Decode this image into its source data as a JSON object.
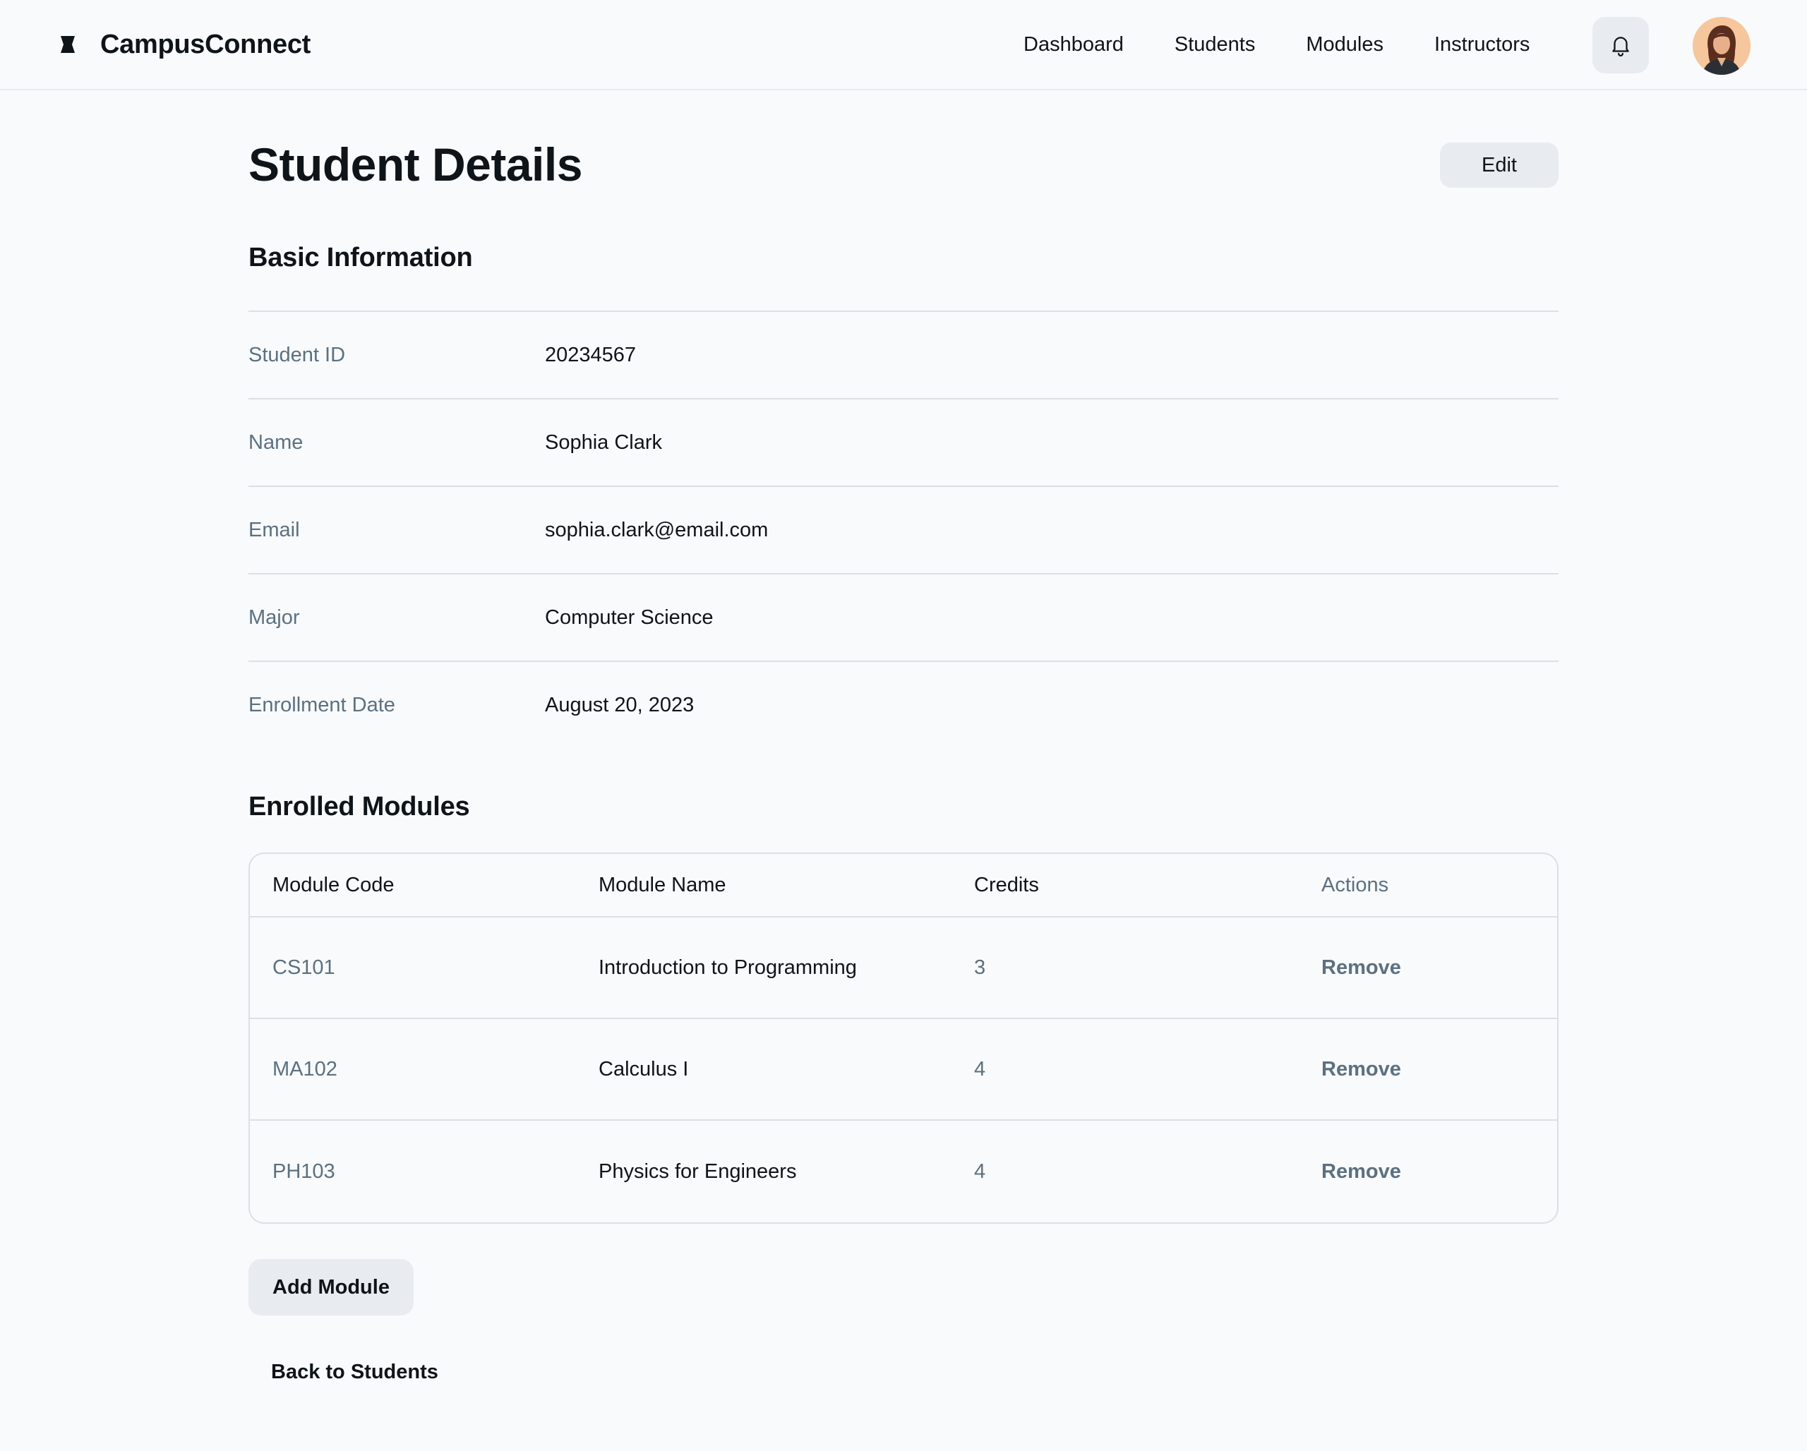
{
  "header": {
    "brand_name": "CampusConnect",
    "brand_icon": "hourglass-logo-icon",
    "nav": [
      "Dashboard",
      "Students",
      "Modules",
      "Instructors"
    ],
    "bell_icon": "bell-icon",
    "avatar_icon": "user-avatar"
  },
  "page": {
    "title": "Student Details",
    "edit_label": "Edit"
  },
  "basic_info": {
    "title": "Basic Information",
    "rows": [
      {
        "label": "Student ID",
        "value": "20234567"
      },
      {
        "label": "Name",
        "value": "Sophia Clark"
      },
      {
        "label": "Email",
        "value": "sophia.clark@email.com"
      },
      {
        "label": "Major",
        "value": "Computer Science"
      },
      {
        "label": "Enrollment Date",
        "value": "August 20, 2023"
      }
    ]
  },
  "modules": {
    "title": "Enrolled Modules",
    "columns": [
      "Module Code",
      "Module Name",
      "Credits",
      "Actions"
    ],
    "rows": [
      {
        "code": "CS101",
        "name": "Introduction to Programming",
        "credits": "3",
        "action": "Remove"
      },
      {
        "code": "MA102",
        "name": "Calculus I",
        "credits": "4",
        "action": "Remove"
      },
      {
        "code": "PH103",
        "name": "Physics for Engineers",
        "credits": "4",
        "action": "Remove"
      }
    ],
    "add_label": "Add Module"
  },
  "footer": {
    "back_label": "Back to Students"
  },
  "colors": {
    "background": "#f8fafc",
    "text": "#0f1419",
    "muted": "#5c7080",
    "button_bg": "#e8ecf0",
    "border": "#dbe0e5"
  }
}
